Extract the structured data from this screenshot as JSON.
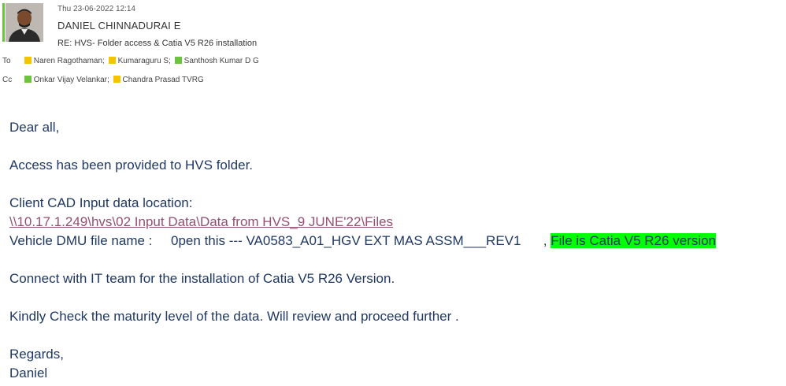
{
  "header": {
    "date": "Thu 23-06-2022 12:14",
    "sender": "DANIEL CHINNADURAI E",
    "subject": "RE: HVS- Folder access & Catia V5 R26 installation",
    "to_label": "To",
    "cc_label": "Cc",
    "to": [
      {
        "name": "Naren Ragothaman;",
        "status_color": "#f5c400"
      },
      {
        "name": "Kumaraguru S;",
        "status_color": "#f5c400"
      },
      {
        "name": "Santhosh Kumar D G",
        "status_color": "#6bc43d"
      }
    ],
    "cc": [
      {
        "name": "Onkar Vijay Velankar;",
        "status_color": "#6bc43d"
      },
      {
        "name": "Chandra Prasad TVRG",
        "status_color": "#f5c400"
      }
    ]
  },
  "body": {
    "greeting": "Dear all,",
    "access_line": "Access has been provided to HVS folder.",
    "location_label": "Client CAD Input data location:",
    "location_path": "\\\\10.17.1.249\\hvs\\02 Input Data\\Data from HVS_9 JUNE'22\\Files",
    "dmu_prefix": "Vehicle DMU file name :     0pen this --- VA0583_A01_HGV EXT MAS ASSM___REV1      , ",
    "dmu_highlight": "File is Catia V5 R26 version",
    "it_line": "Connect with IT team for the installation of Catia V5 R26 Version.",
    "check_line": "Kindly Check the maturity level of the data. Will review and proceed further .",
    "regards": "Regards,",
    "signature": "Daniel"
  },
  "colors": {
    "body_text": "#1f3864",
    "link": "#954f72",
    "highlight": "#00ff00",
    "presence_available": "#6bc43d",
    "presence_away": "#f5c400"
  }
}
